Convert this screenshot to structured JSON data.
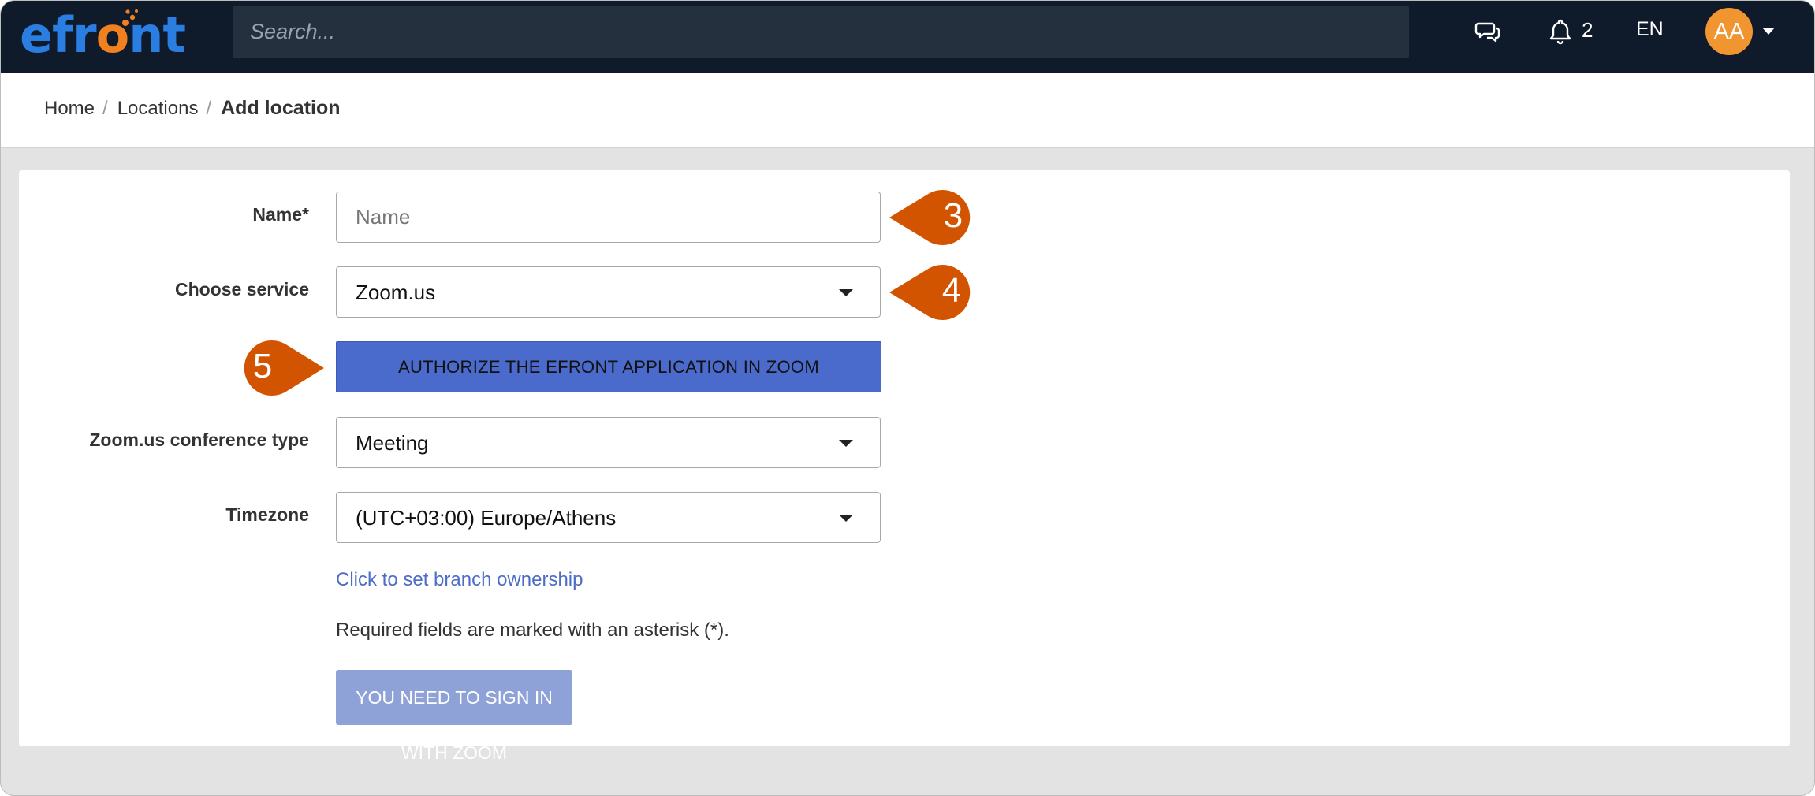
{
  "app": {
    "logo_text": "efront",
    "logo_part_before": "efr",
    "logo_part_o": "o",
    "logo_part_after": "nt"
  },
  "topbar": {
    "search_placeholder": "Search...",
    "icons": [
      "chat-icon",
      "bell-icon"
    ],
    "notification_count": "2",
    "language": "EN",
    "avatar_initials": "AA"
  },
  "breadcrumb": {
    "items": [
      "Home",
      "Locations"
    ],
    "current": "Add location",
    "separator": "/"
  },
  "form": {
    "name_label": "Name*",
    "name_placeholder": "Name",
    "name_value": "",
    "service_label": "Choose service",
    "service_value": "Zoom.us",
    "authorize_label": "AUTHORIZE THE EFRONT APPLICATION IN ZOOM",
    "conference_type_label": "Zoom.us conference type",
    "conference_type_value": "Meeting",
    "timezone_label": "Timezone",
    "timezone_value": "(UTC+03:00) Europe/Athens",
    "branch_link": "Click to set branch ownership",
    "required_note": "Required fields are marked with an asterisk (*).",
    "signin_label": "YOU NEED TO SIGN IN WITH ZOOM"
  },
  "callouts": [
    "3",
    "4",
    "5"
  ],
  "colors": {
    "topbar_bg": "#0f1b2b",
    "search_bg": "#25303f",
    "logo_blue": "#2a7de1",
    "logo_orange": "#f08020",
    "avatar_bg": "#f0952f",
    "primary_button": "#4a6bcc",
    "disabled_button": "#8fa2d8",
    "link": "#4d6cc6",
    "callout": "#d35400"
  }
}
